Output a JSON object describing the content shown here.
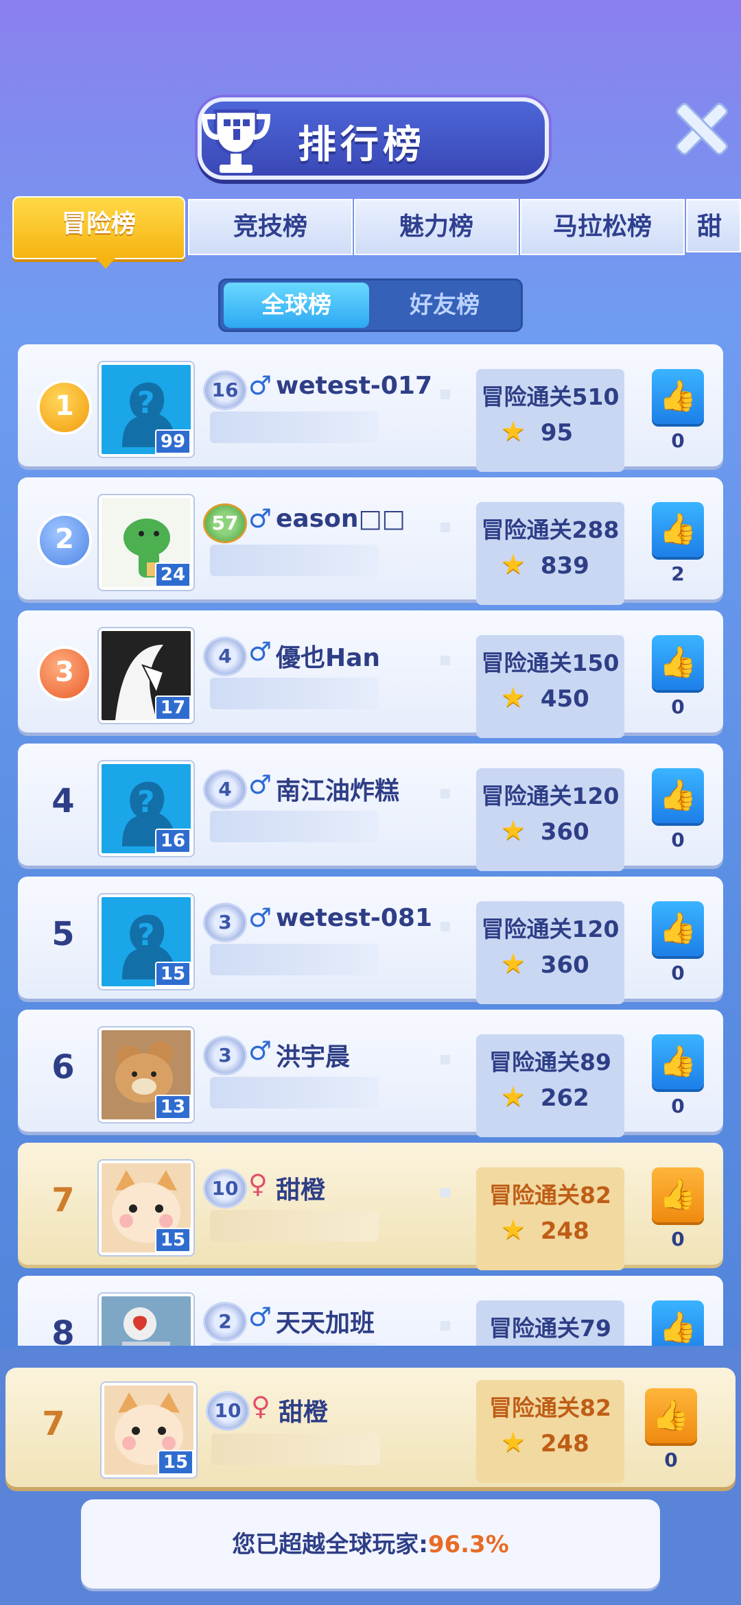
{
  "header": {
    "title": "排行榜",
    "close_icon": "close-icon"
  },
  "tabs": [
    "冒险榜",
    "竞技榜",
    "魅力榜",
    "马拉松榜",
    "甜"
  ],
  "subtabs": {
    "global": "全球榜",
    "friends": "好友榜"
  },
  "rows": [
    {
      "rank": "1",
      "medal": "gold",
      "avatar": "default",
      "avatar_level": "99",
      "level": "16",
      "gender": "♂",
      "name": "wetest-017",
      "score_label": "冒险通关510",
      "stars": "95",
      "likes": "0"
    },
    {
      "rank": "2",
      "medal": "silver",
      "avatar": "dino",
      "avatar_level": "24",
      "level": "57",
      "gender": "♂",
      "name": "eason□□",
      "score_label": "冒险通关288",
      "stars": "839",
      "likes": "2"
    },
    {
      "rank": "3",
      "medal": "bronze",
      "avatar": "girl",
      "avatar_level": "17",
      "level": "4",
      "gender": "♂",
      "name": "優也Han",
      "score_label": "冒险通关150",
      "stars": "450",
      "likes": "0"
    },
    {
      "rank": "4",
      "avatar": "default",
      "avatar_level": "16",
      "level": "4",
      "gender": "♂",
      "name": "南江油炸糕",
      "score_label": "冒险通关120",
      "stars": "360",
      "likes": "0"
    },
    {
      "rank": "5",
      "avatar": "default",
      "avatar_level": "15",
      "level": "3",
      "gender": "♂",
      "name": "wetest-081",
      "score_label": "冒险通关120",
      "stars": "360",
      "likes": "0"
    },
    {
      "rank": "6",
      "avatar": "bear",
      "avatar_level": "13",
      "level": "3",
      "gender": "♂",
      "name": "洪宇晨",
      "score_label": "冒险通关89",
      "stars": "262",
      "likes": "0"
    },
    {
      "rank": "7",
      "avatar": "cat",
      "avatar_level": "15",
      "level": "10",
      "gender": "♀",
      "name": "甜橙",
      "score_label": "冒险通关82",
      "stars": "248",
      "likes": "0",
      "self": true
    },
    {
      "rank": "8",
      "avatar": "robot",
      "avatar_level": "",
      "level": "2",
      "gender": "♂",
      "name": "天天加班",
      "score_label": "冒险通关79",
      "stars": "",
      "likes": ""
    }
  ],
  "self_row": {
    "rank": "7",
    "avatar_level": "15",
    "level": "10",
    "gender": "♀",
    "name": "甜橙",
    "score_label": "冒险通关82",
    "stars": "248",
    "likes": "0"
  },
  "summary": {
    "prefix": "您已超越全球玩家:",
    "percent": "96.3%"
  },
  "colors": {
    "accent_gold": "#f6b412",
    "accent_blue": "#2da8f3",
    "self_highlight": "#f1e3b8"
  }
}
